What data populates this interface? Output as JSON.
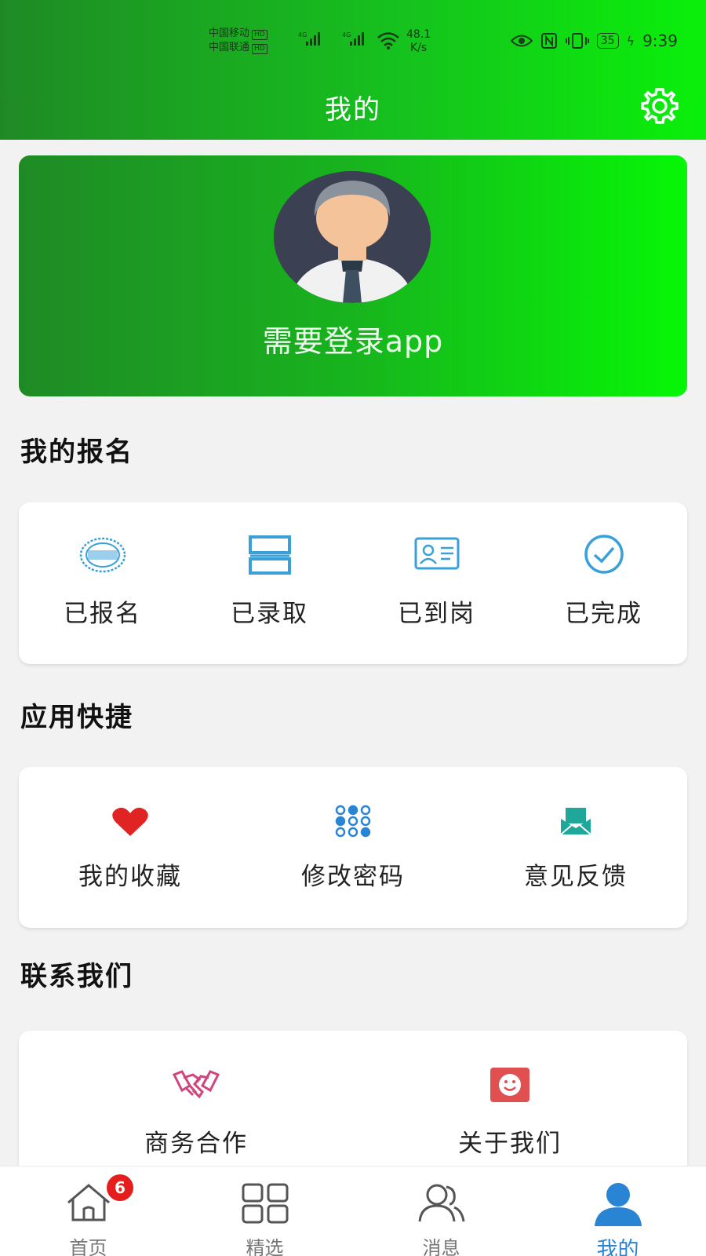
{
  "status_bar": {
    "carrier1": "中国移动",
    "carrier2": "中国联通",
    "hd": "HD",
    "net": "4G",
    "speed_value": "48.1",
    "speed_unit": "K/s",
    "battery": "35",
    "time": "9:39"
  },
  "header": {
    "title": "我的"
  },
  "profile": {
    "login_text": "需要登录app"
  },
  "section_signup": {
    "title": "我的报名",
    "items": [
      {
        "label": "已报名",
        "icon": "stamp-icon"
      },
      {
        "label": "已录取",
        "icon": "list-icon"
      },
      {
        "label": "已到岗",
        "icon": "id-card-icon"
      },
      {
        "label": "已完成",
        "icon": "check-circle-icon"
      }
    ]
  },
  "section_shortcuts": {
    "title": "应用快捷",
    "items": [
      {
        "label": "我的收藏",
        "icon": "heart-icon"
      },
      {
        "label": "修改密码",
        "icon": "keypad-icon"
      },
      {
        "label": "意见反馈",
        "icon": "mail-icon"
      }
    ]
  },
  "section_contact": {
    "title": "联系我们",
    "items": [
      {
        "label": "商务合作",
        "icon": "handshake-icon"
      },
      {
        "label": "关于我们",
        "icon": "smile-icon"
      }
    ]
  },
  "tabbar": {
    "badge": "6",
    "tabs": [
      {
        "label": "首页",
        "icon": "home-icon"
      },
      {
        "label": "精选",
        "icon": "grid-icon"
      },
      {
        "label": "消息",
        "icon": "users-icon"
      },
      {
        "label": "我的",
        "icon": "user-icon"
      }
    ]
  },
  "colors": {
    "green_dark": "#1f8a25",
    "green_bright": "#0af00a",
    "accent_blue": "#2a84d4",
    "icon_blue": "#3aa0d8",
    "heart_red": "#e02424",
    "badge_red": "#e41d1d",
    "teal": "#1fa79a",
    "pink": "#d0457f"
  }
}
